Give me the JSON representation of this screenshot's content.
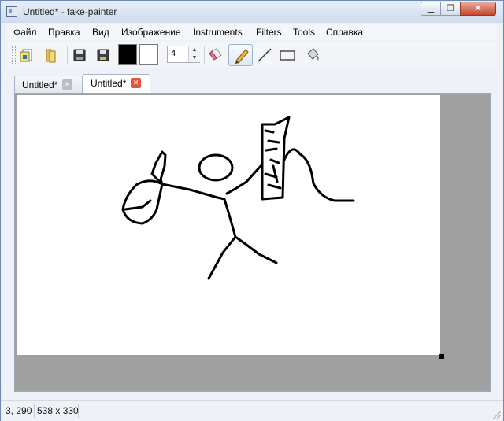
{
  "window": {
    "title": "Untitled* - fake-painter",
    "minimize_label": "▁",
    "maximize_label": "❐",
    "close_label": "✕"
  },
  "menu": [
    "Файл",
    "Правка",
    "Вид",
    "Изображение",
    "Instruments",
    "Filters",
    "Tools",
    "Справка"
  ],
  "toolbar": {
    "icons": [
      "new-file-icon",
      "open-folder-icon",
      "save-icon",
      "save-as-icon",
      "eraser-icon",
      "pencil-icon",
      "line-icon",
      "rectangle-icon",
      "fill-bucket-icon"
    ],
    "active_tool": "pencil",
    "primary_color": "#000000",
    "secondary_color": "#ffffff",
    "pen_size": "4"
  },
  "tabs": [
    {
      "label": "Untitled*",
      "active": false
    },
    {
      "label": "Untitled*",
      "active": true
    }
  ],
  "canvas": {
    "background": "#ffffff",
    "workspace_color": "#a0a0a0"
  },
  "status": {
    "cursor": "3, 290",
    "image_size": "538 x 330"
  }
}
